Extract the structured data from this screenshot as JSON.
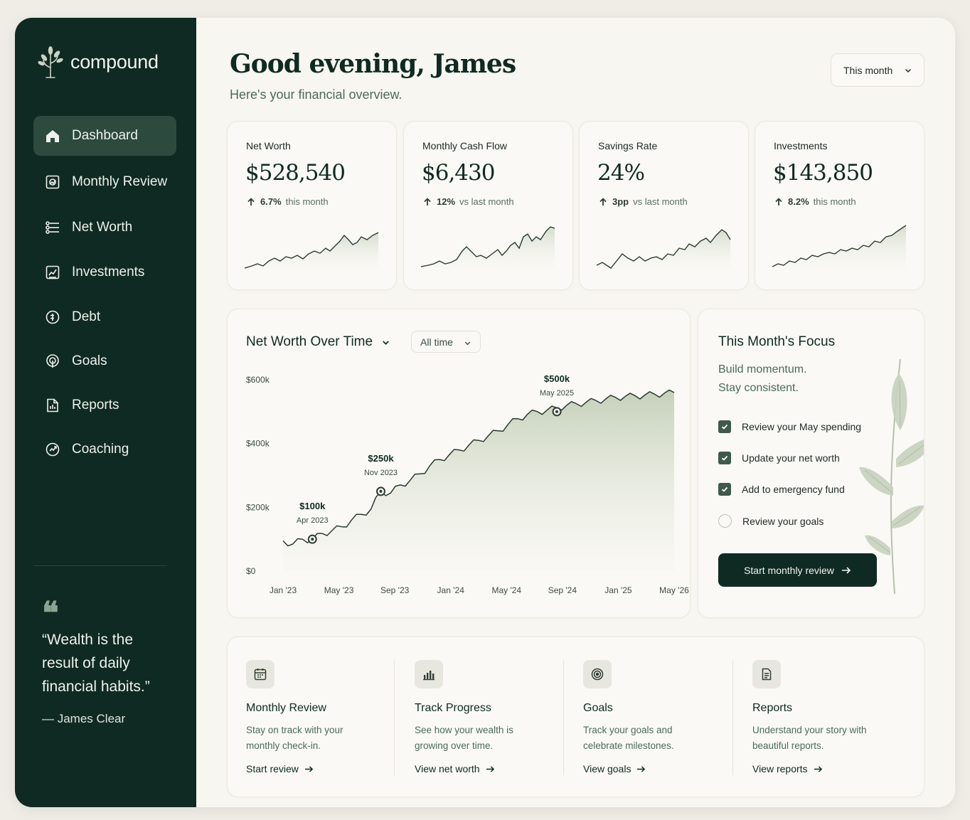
{
  "app": {
    "name": "compound"
  },
  "sidebar": {
    "items": [
      {
        "label": "Dashboard",
        "icon": "home-icon",
        "active": true
      },
      {
        "label": "Monthly Review",
        "icon": "review-icon"
      },
      {
        "label": "Net Worth",
        "icon": "networth-icon"
      },
      {
        "label": "Investments",
        "icon": "investments-icon"
      },
      {
        "label": "Debt",
        "icon": "debt-icon"
      },
      {
        "label": "Goals",
        "icon": "goals-icon"
      },
      {
        "label": "Reports",
        "icon": "reports-icon"
      },
      {
        "label": "Coaching",
        "icon": "coaching-icon"
      }
    ],
    "quote": {
      "mark": "66",
      "text": "“Wealth is the result of daily financial habits.”",
      "author": "— James Clear"
    }
  },
  "header": {
    "greeting": "Good evening, James",
    "subtitle": "Here's your financial overview.",
    "period": "This month"
  },
  "kpis": [
    {
      "label": "Net Worth",
      "value": "$528,540",
      "change": "6.7%",
      "note": "this month"
    },
    {
      "label": "Monthly Cash Flow",
      "value": "$6,430",
      "change": "12%",
      "note": "vs last month"
    },
    {
      "label": "Savings Rate",
      "value": "24%",
      "change": "3pp",
      "note": "vs last month"
    },
    {
      "label": "Investments",
      "value": "$143,850",
      "change": "8.2%",
      "note": "this month"
    }
  ],
  "net_worth_chart": {
    "title": "Net Worth Over Time",
    "range": "All time"
  },
  "chart_data": {
    "type": "area",
    "title": "Net Worth Over Time",
    "x_tick_labels": [
      "Jan '23",
      "May '23",
      "Sep '23",
      "Jan '24",
      "May '24",
      "Sep '24",
      "Jan '25",
      "May '26"
    ],
    "y_tick_labels": [
      "$600k",
      "$400k",
      "$200k",
      "$0"
    ],
    "ylim": [
      0,
      600000
    ],
    "grid": false,
    "series": [
      {
        "x": [
          "2023-01",
          "2023-02",
          "2023-03",
          "2023-04",
          "2023-05",
          "2023-06",
          "2023-07",
          "2023-08",
          "2023-09",
          "2023-10",
          "2023-11",
          "2023-12",
          "2024-01",
          "2024-02",
          "2024-03",
          "2024-04",
          "2024-05",
          "2024-06",
          "2024-07",
          "2024-08",
          "2024-09",
          "2024-10",
          "2024-11",
          "2024-12",
          "2025-01",
          "2025-02",
          "2025-03",
          "2025-04",
          "2025-05",
          "2025-06",
          "2025-07",
          "2025-08",
          "2025-09",
          "2025-10",
          "2025-11",
          "2025-12",
          "2026-01",
          "2026-02",
          "2026-03",
          "2026-04",
          "2026-05"
        ],
        "values": [
          95000,
          85000,
          100000,
          100000,
          118000,
          127000,
          139000,
          160000,
          178000,
          195000,
          250000,
          245000,
          270000,
          285000,
          305000,
          330000,
          350000,
          365000,
          380000,
          395000,
          410000,
          425000,
          440000,
          460000,
          478000,
          492000,
          500000,
          505000,
          512000,
          520000,
          525000,
          530000,
          535000,
          540000,
          545000,
          548000,
          550000,
          552000,
          555000,
          558000,
          560000
        ]
      }
    ],
    "annotations": [
      {
        "label": "$100k",
        "date": "Apr 2023",
        "x": "2023-04",
        "y": 100000
      },
      {
        "label": "$250k",
        "date": "Nov 2023",
        "x": "2023-11",
        "y": 250000
      },
      {
        "label": "$500k",
        "date": "May 2025",
        "x": "2025-05",
        "y": 500000
      }
    ]
  },
  "focus": {
    "title": "This Month's Focus",
    "subtitle_1": "Build momentum.",
    "subtitle_2": "Stay consistent.",
    "tasks": [
      {
        "label": "Review your May spending",
        "done": true
      },
      {
        "label": "Update your net worth",
        "done": true
      },
      {
        "label": "Add to emergency fund",
        "done": true
      },
      {
        "label": "Review your goals",
        "done": false
      }
    ],
    "cta": "Start monthly review"
  },
  "quick_actions": [
    {
      "icon": "calendar-icon",
      "title": "Monthly Review",
      "desc": "Stay on track with your monthly check-in.",
      "link": "Start review"
    },
    {
      "icon": "bar-chart-icon",
      "title": "Track Progress",
      "desc": "See how your wealth is growing over time.",
      "link": "View net worth"
    },
    {
      "icon": "target-icon",
      "title": "Goals",
      "desc": "Track your goals and celebrate milestones.",
      "link": "View goals"
    },
    {
      "icon": "document-icon",
      "title": "Reports",
      "desc": "Understand your story with beautiful reports.",
      "link": "View reports"
    }
  ],
  "colors": {
    "sidebar": "#0f2a22",
    "accent": "#3f5a4c",
    "area": "#c9d3bf",
    "background": "#f8f6f1"
  }
}
